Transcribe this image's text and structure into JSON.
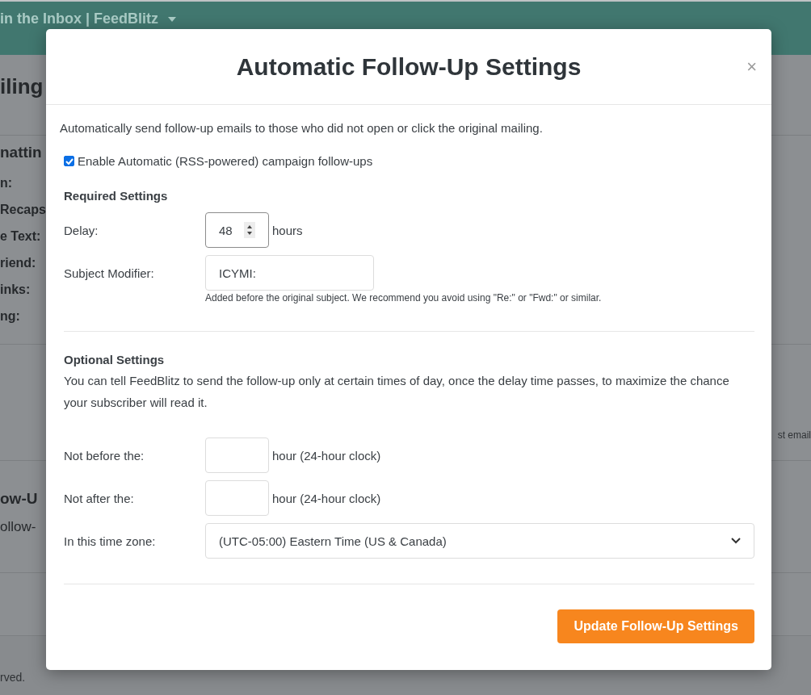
{
  "background_page": {
    "header_title": "in the Inbox | FeedBlitz",
    "heading": "iling",
    "section_heading": "nattin",
    "labels": [
      "n:",
      "Recaps",
      "e Text:",
      "riend:",
      "inks:",
      "ng:"
    ],
    "side_text": "st email",
    "followup_heading": "ow-U",
    "followup_text": "ollow-",
    "footer_text": "rved."
  },
  "dialog": {
    "title": "Automatic Follow-Up Settings",
    "close": "×",
    "intro": "Automatically send follow-up emails to those who did not open or click the original mailing.",
    "enable_checkbox": {
      "label": "Enable Automatic (RSS-powered) campaign follow-ups",
      "checked": true
    },
    "required": {
      "heading": "Required Settings",
      "delay": {
        "label": "Delay:",
        "value": "48",
        "unit": "hours"
      },
      "subject_modifier": {
        "label": "Subject Modifier:",
        "value": "ICYMI:",
        "help": "Added before the original subject. We recommend you avoid using \"Re:\" or \"Fwd:\" or similar."
      }
    },
    "optional": {
      "heading": "Optional Settings",
      "text": "You can tell FeedBlitz to send the follow-up only at certain times of day, once the delay time passes, to maximize the chance your subscriber will read it.",
      "not_before": {
        "label": "Not before the:",
        "unit": "hour (24-hour clock)"
      },
      "not_after": {
        "label": "Not after the:",
        "unit": "hour (24-hour clock)"
      },
      "time_zone": {
        "label": "In this time zone:",
        "value": "(UTC-05:00) Eastern Time (US & Canada)"
      }
    },
    "submit": "Update Follow-Up Settings"
  }
}
